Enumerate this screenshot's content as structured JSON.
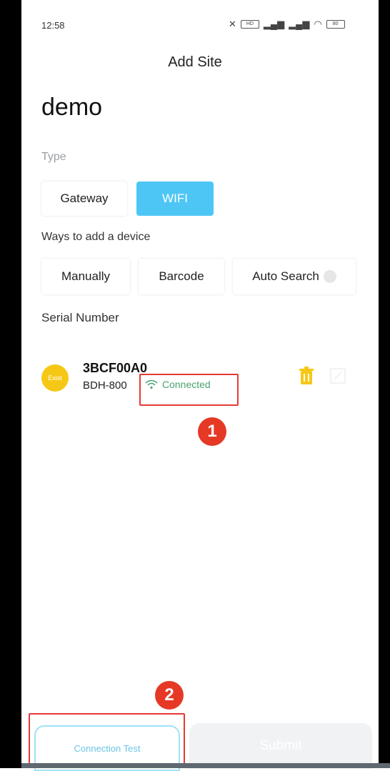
{
  "status_bar": {
    "time": "12:58",
    "icons": [
      "mute-icon",
      "hd-icon",
      "signal-5g-icon",
      "signal-5g-icon-2",
      "wifi-icon",
      "battery-icon"
    ],
    "hd_text": "HD",
    "battery_text": "80"
  },
  "header": {
    "title": "Add Site"
  },
  "site": {
    "name": "demo"
  },
  "type_section": {
    "label": "Type",
    "options": [
      "Gateway",
      "WIFI"
    ],
    "selected": "WIFI"
  },
  "ways_section": {
    "label": "Ways to add a device",
    "options": [
      "Manually",
      "Barcode",
      "Auto Search"
    ]
  },
  "serial_section": {
    "label": "Serial Number"
  },
  "device": {
    "avatar_text": "Exist",
    "serial": "3BCF00A0",
    "model": "BDH-800",
    "status": "Connected",
    "status_color": "#4aa36f"
  },
  "annotations": {
    "badge_1": "1",
    "badge_2": "2"
  },
  "footer": {
    "connection_test_label": "Connection Test",
    "submit_label": "Submit"
  },
  "colors": {
    "accent": "#4ec6f5",
    "avatar": "#f6c816",
    "highlight": "#e53935"
  }
}
